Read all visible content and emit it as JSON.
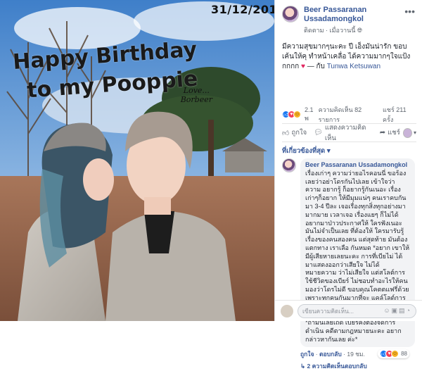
{
  "photo": {
    "date_stamp": "31/12/2018",
    "headline_line1": "Happy Birthday",
    "headline_line2": "to my Pooppie",
    "signoff_line1": "Love...",
    "signoff_line2": "Borbeer",
    "sky_color": "#4d8cd4",
    "ground_color": "#9a6b4e"
  },
  "post": {
    "author_line1": "Beer Passaranan",
    "author_line2": "Ussadamongkol",
    "follow_label": "ติดตาม",
    "timestamp": "เมื่อวานนี้",
    "caption": "มีความสุขมากๆนะคะ ปี เอ็งมันน่ารัก ขอบเค้นให้คุ ทำหน้าเคลื่อ ได้ความมากๆใจแป้งกกกก",
    "tagged_user": "Tunwa Ketsuwan",
    "caption_suffix": "— กับ",
    "reaction_summary": "2.1 พ",
    "comments_count": "ความคิดเห็น 82 รายการ",
    "shares_count": "แชร์ 211 ครั้ง",
    "like_label": "ถูกใจ",
    "comment_label": "แสดงความคิดเห็น",
    "share_label": "แชร์"
  },
  "comments": {
    "sort_label": "ที่เกี่ยวข้องที่สุด",
    "items": [
      {
        "author": "Beer Passaranan Ussadamongkol",
        "text": "เรื่องเก่าๆ ความว่ายอไรคอนนี่ ขอร้อง เลยว่าอย่าโดรกันไปเลย เข้าใจว่าความ อยากรู้ ก็อยากรู้กันเนอะ เรื่องเก่าๆก็อยาก ให้มีมุมแน่ๆ คนเราคบกันมา 3-4 ปีละ เจอเรื่องทุกสิ่งทุกอย่างมามากมาย เวลาเจอ เรื่องแยๆ ก็ไม่ได้อยากมาป่าวประกาศให้ ใครฟังเนอะ มันไม่จำเป็นเลย ที่ต้องให้ ใครมารับรู้เรื่องของคนสองคน แต่สุดท้าย มันต้องแตกทาง เราเลือ กันหมด *อยาก เขาให้มีผู้เสียหายเลยนะคะ การที่เบียไม่ ได้มาแสดงออกว่าเสียใจ ไม่ได้หมายความ ว่าไม่เสียใจ แต่สโลต์การใช้ชีวิตของเบียร์ ไม่ชอบทำอะไรให้คนมองว่าโดรไม่ดี ขอบคุณโคตตแฟรี่ด้วย เพราะทุกคนกันมากที่จะ แคล์โลต์การใช้ชีวิตคนเรามันต่างกัน\n\n*ถ้ามันเลยเถิด เบียร์คงต้องจัดการดำเนิน คดีตามกฎหมายนะคะ อยากกล่าวหากันเลย ค่ะ*",
        "like_label": "ถูกใจ",
        "reply_label": "ตอบกลับ",
        "time": "19 ชม.",
        "reaction_count": "88",
        "replies_label": "2 ความคิดเห็นตอบกลับ"
      }
    ],
    "input_placeholder": "เขียนความคิดเห็น..."
  },
  "icons": {
    "more": "more-icon",
    "like": "thumbs-up-icon",
    "comment": "speech-bubble-icon",
    "share": "share-arrow-icon"
  }
}
